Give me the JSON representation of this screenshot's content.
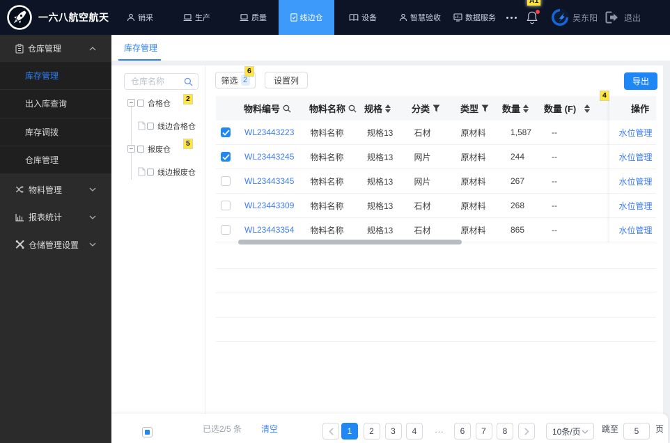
{
  "topbar": {
    "brand": "一六八航空航天",
    "nav": [
      {
        "label": "销采",
        "icon": "user-icon",
        "active": false
      },
      {
        "label": "生产",
        "icon": "laptop-icon",
        "active": false
      },
      {
        "label": "质量",
        "icon": "laptop-icon",
        "active": false
      },
      {
        "label": "线边仓",
        "icon": "document-check-icon",
        "active": true
      },
      {
        "label": "设备",
        "icon": "book-icon",
        "active": false
      },
      {
        "label": "智慧验收",
        "icon": "user-icon",
        "active": false
      },
      {
        "label": "数据服务",
        "icon": "data-chart-icon",
        "active": false
      }
    ],
    "username": "吴东阳",
    "logout_label": "退出"
  },
  "sidebar": {
    "groups": [
      {
        "label": "仓库管理",
        "icon": "clipboard-icon",
        "expanded": true
      },
      {
        "label": "物料管理",
        "icon": "shuffle-icon",
        "expanded": false
      },
      {
        "label": "报表统计",
        "icon": "barchart-icon",
        "expanded": false
      },
      {
        "label": "仓储管理设置",
        "icon": "tools-icon",
        "expanded": false
      }
    ],
    "warehouse_children": [
      {
        "label": "库存管理",
        "active": true
      },
      {
        "label": "出入库查询",
        "active": false
      },
      {
        "label": "库存调拨",
        "active": false
      },
      {
        "label": "仓库管理",
        "active": false
      }
    ]
  },
  "tabs": {
    "items": [
      {
        "label": "库存管理",
        "active": true
      }
    ]
  },
  "tree": {
    "search_placeholder": "仓库名称",
    "nodes": [
      {
        "label": "合格仓",
        "level": 0,
        "expanded": true,
        "checked": false
      },
      {
        "label": "线边合格仓",
        "level": 1,
        "checked": false
      },
      {
        "label": "报废仓",
        "level": 0,
        "expanded": true,
        "checked": false
      },
      {
        "label": "线边报废仓",
        "level": 1,
        "checked": false
      }
    ]
  },
  "toolbar": {
    "filter_label": "筛选",
    "filter_count": "2",
    "columns_label": "设置列",
    "export_label": "导出"
  },
  "table": {
    "headers": {
      "code": "物料编号",
      "name": "物料名称",
      "spec": "规格",
      "category": "分类",
      "type": "类型",
      "qty": "数量",
      "qty_f": "数量 (F)",
      "action": "操作"
    },
    "rows": [
      {
        "checked": true,
        "code": "WL23443223",
        "name": "物料名称",
        "spec": "规格13",
        "category": "石材",
        "type": "原材料",
        "qty": "1,587",
        "qty_f": "--",
        "action": "水位管理"
      },
      {
        "checked": true,
        "code": "WL23443245",
        "name": "物料名称",
        "spec": "规格13",
        "category": "网片",
        "type": "原材料",
        "qty": "244",
        "qty_f": "--",
        "action": "水位管理"
      },
      {
        "checked": false,
        "code": "WL23443345",
        "name": "物料名称",
        "spec": "规格13",
        "category": "网片",
        "type": "原材料",
        "qty": "267",
        "qty_f": "--",
        "action": "水位管理"
      },
      {
        "checked": false,
        "code": "WL23443309",
        "name": "物料名称",
        "spec": "规格13",
        "category": "石材",
        "type": "原材料",
        "qty": "268",
        "qty_f": "--",
        "action": "水位管理"
      },
      {
        "checked": false,
        "code": "WL23443354",
        "name": "物料名称",
        "spec": "规格13",
        "category": "石材",
        "type": "原材料",
        "qty": "865",
        "qty_f": "--",
        "action": "水位管理"
      }
    ]
  },
  "footer": {
    "selected_text": "已选2/5 条",
    "clear_label": "清空",
    "pages": [
      "1",
      "2",
      "3",
      "4",
      "6",
      "7",
      "8"
    ],
    "ellipsis": "...",
    "active_page": "1",
    "page_size": "10条/页",
    "jump_label": "跳至",
    "jump_value": "5",
    "page_unit": "页"
  },
  "annotations": {
    "marks": [
      {
        "label": "A1",
        "target": "notification-bell"
      },
      {
        "label": "2",
        "target": "tree-node-qualified"
      },
      {
        "label": "4",
        "target": "table-column-qty-f"
      },
      {
        "label": "5",
        "target": "tree-node-scrap"
      },
      {
        "label": "6",
        "target": "filter-button"
      }
    ]
  },
  "colors": {
    "topbar_bg": "#0c1425",
    "nav_active": "#3d99fa",
    "sidebar_bg": "#2b2b2b",
    "submenu_bg": "#1f1f20",
    "accent_blue": "#2188f3",
    "link_blue": "#3e7cf7",
    "page_bg": "#eef0f3",
    "header_bg": "#f6f7f9",
    "mark_yellow": "#ffe53d"
  }
}
